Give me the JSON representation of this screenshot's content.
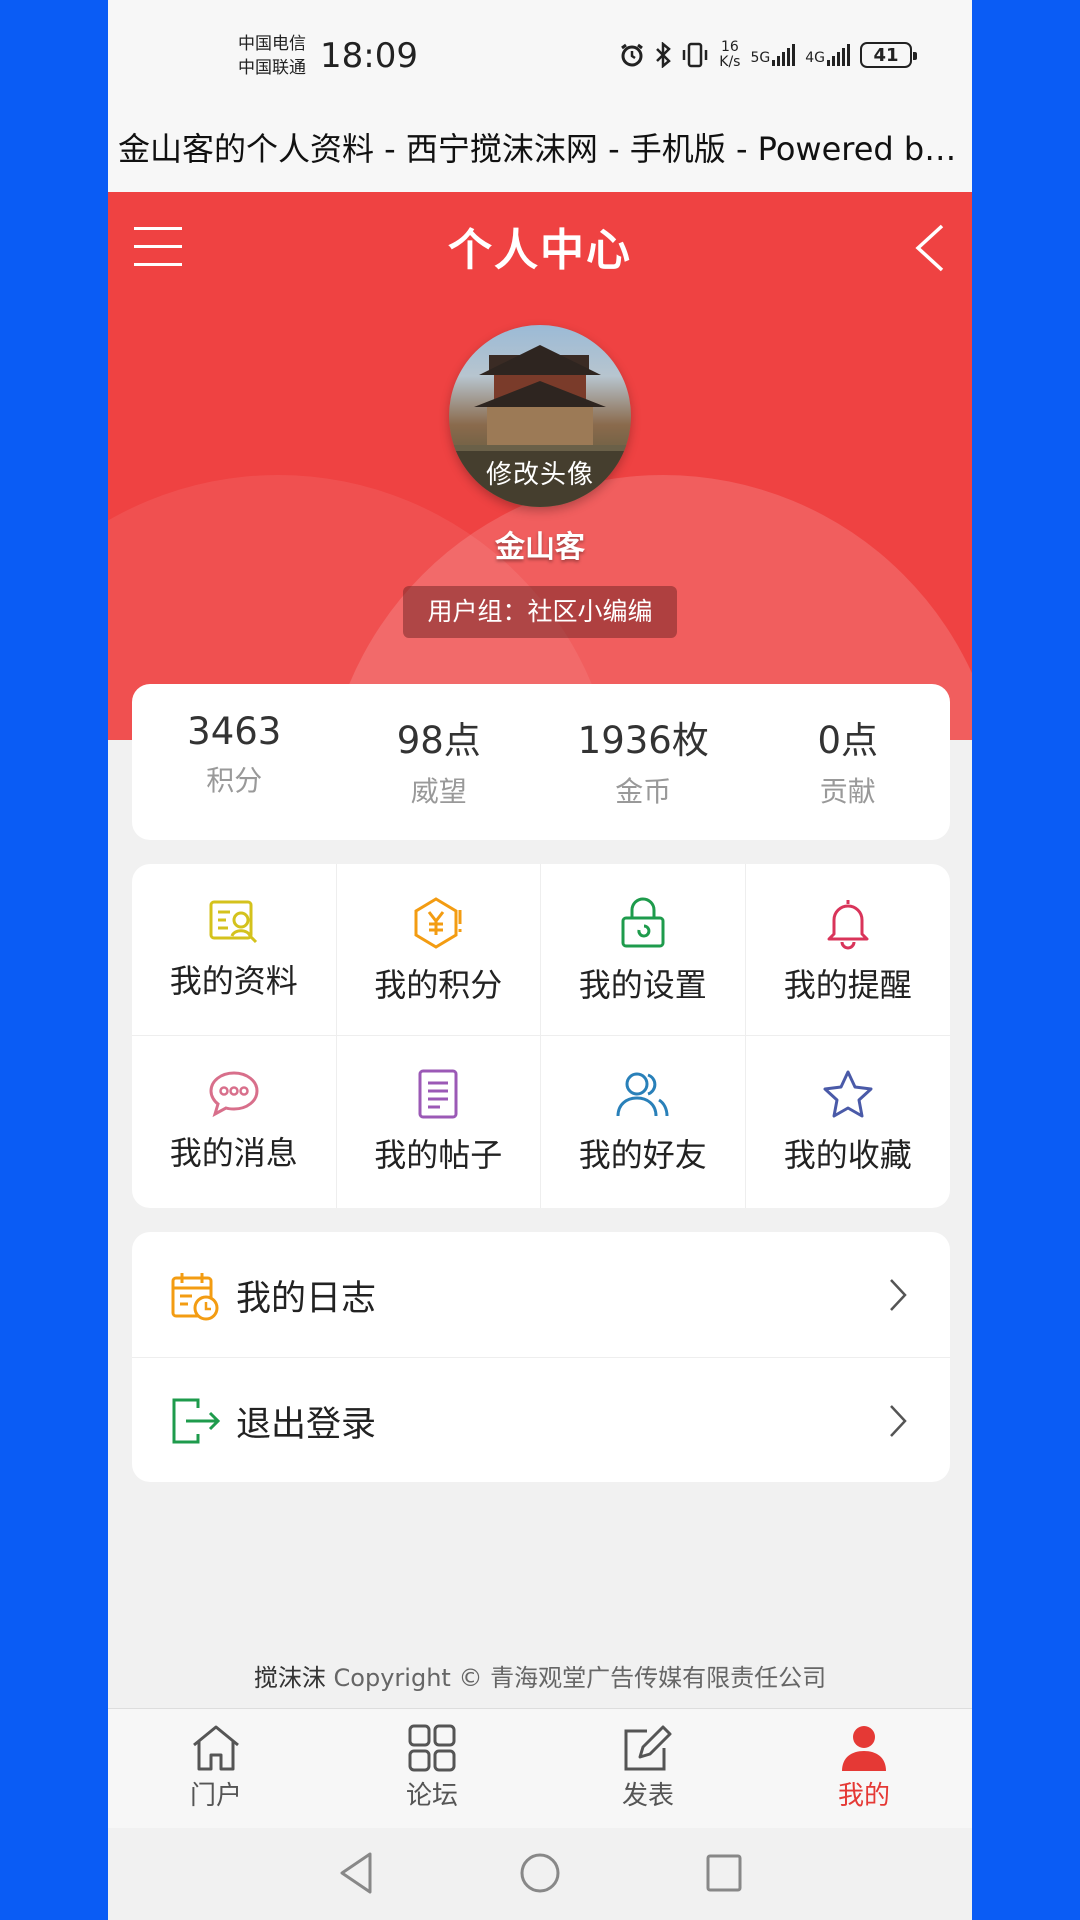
{
  "status_bar": {
    "carrier_1": "中国电信",
    "carrier_2": "中国联通",
    "time": "18:09",
    "speed_value": "16",
    "speed_unit": "K/s",
    "net_1": "5G",
    "net_2": "4G",
    "battery": "41"
  },
  "browser": {
    "title": "金山客的个人资料 - 西宁搅沫沫网 - 手机版 - Powered by Discuz!"
  },
  "header": {
    "title": "个人中心",
    "avatar_label": "修改头像",
    "username": "金山客",
    "user_group": "用户组：社区小编编"
  },
  "stats": [
    {
      "value": "3463",
      "label": "积分"
    },
    {
      "value": "98点",
      "label": "威望"
    },
    {
      "value": "1936枚",
      "label": "金币"
    },
    {
      "value": "0点",
      "label": "贡献"
    }
  ],
  "grid": [
    {
      "label": "我的资料",
      "icon": "profile-card-icon",
      "color": "#d4c21c"
    },
    {
      "label": "我的积分",
      "icon": "points-hexagon-icon",
      "color": "#f39c12"
    },
    {
      "label": "我的设置",
      "icon": "lock-icon",
      "color": "#1e9b4c"
    },
    {
      "label": "我的提醒",
      "icon": "bell-icon",
      "color": "#d9345a"
    },
    {
      "label": "我的消息",
      "icon": "chat-bubble-icon",
      "color": "#d86f8b"
    },
    {
      "label": "我的帖子",
      "icon": "document-icon",
      "color": "#9b59b6"
    },
    {
      "label": "我的好友",
      "icon": "friends-icon",
      "color": "#2980b9"
    },
    {
      "label": "我的收藏",
      "icon": "star-icon",
      "color": "#4a5aa8"
    }
  ],
  "list": [
    {
      "label": "我的日志",
      "icon": "calendar-icon",
      "color": "#f39c12"
    },
    {
      "label": "退出登录",
      "icon": "logout-icon",
      "color": "#1e9b4c"
    }
  ],
  "footer": {
    "brand": "搅沫沫",
    "copyright": "Copyright © 青海观堂广告传媒有限责任公司"
  },
  "tabbar": [
    {
      "label": "门户",
      "icon": "home-icon"
    },
    {
      "label": "论坛",
      "icon": "grid-icon"
    },
    {
      "label": "发表",
      "icon": "edit-icon"
    },
    {
      "label": "我的",
      "icon": "user-icon",
      "active": true
    }
  ],
  "colors": {
    "primary_red": "#ef4242",
    "active_tab": "#e53935",
    "page_bg": "#f1f1f1"
  }
}
